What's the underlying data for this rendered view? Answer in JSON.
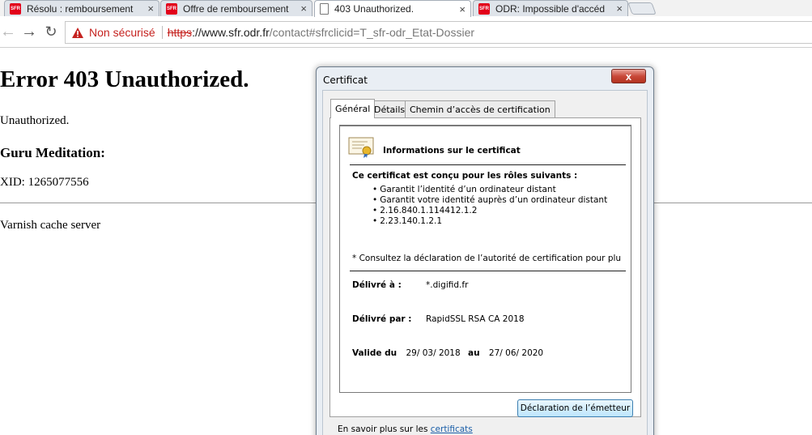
{
  "browser": {
    "tabs": [
      {
        "label": "Résolu : remboursement",
        "favicon": "sfr-favicon",
        "active": false
      },
      {
        "label": "Offre de remboursement",
        "favicon": "sfr-favicon",
        "active": false
      },
      {
        "label": "403 Unauthorized.",
        "favicon": "document-favicon",
        "active": true
      },
      {
        "label": "ODR: Impossible d'accéd",
        "favicon": "sfr-favicon",
        "active": false
      }
    ],
    "favicon_text": "SFR",
    "tab_close_glyph": "×",
    "security_label": "Non sécurisé",
    "url": {
      "scheme": "https",
      "host": "://www.sfr.odr.fr",
      "path": "/contact#sfrclicid=T_sfr-odr_Etat-Dossier"
    },
    "colors": {
      "insecure": "#c5221f",
      "sfr_brand": "#e2001a"
    }
  },
  "page": {
    "title": "Error 403 Unauthorized.",
    "message": "Unauthorized.",
    "guru_heading": "Guru Meditation:",
    "xid": "XID: 1265077556",
    "footer": "Varnish cache server"
  },
  "dialog": {
    "title": "Certificat",
    "close_glyph": "x",
    "tabs": [
      "Général",
      "Détails",
      "Chemin d’accès de certification"
    ],
    "info_heading": "Informations sur le certificat",
    "roles_heading": "Ce certificat est conçu pour les rôles suivants :",
    "roles": [
      "Garantit l’identité d’un ordinateur distant",
      "Garantit votre identité auprès d’un ordinateur distant",
      "2.16.840.1.114412.1.2",
      "2.23.140.1.2.1"
    ],
    "cps_note": "* Consultez la déclaration de l’autorité de certification pour plu",
    "issued_to_label": "Délivré à :",
    "issued_to": "*.digifid.fr",
    "issued_by_label": "Délivré par :",
    "issued_by": "RapidSSL RSA CA 2018",
    "valid_from_label": "Valide du",
    "valid_from": "29/ 03/ 2018",
    "valid_to_label": "au",
    "valid_to": "27/ 06/ 2020",
    "issuer_button": "Déclaration de l’émetteur",
    "learn_more": "En savoir plus sur les ",
    "learn_more_link": "certificats"
  }
}
